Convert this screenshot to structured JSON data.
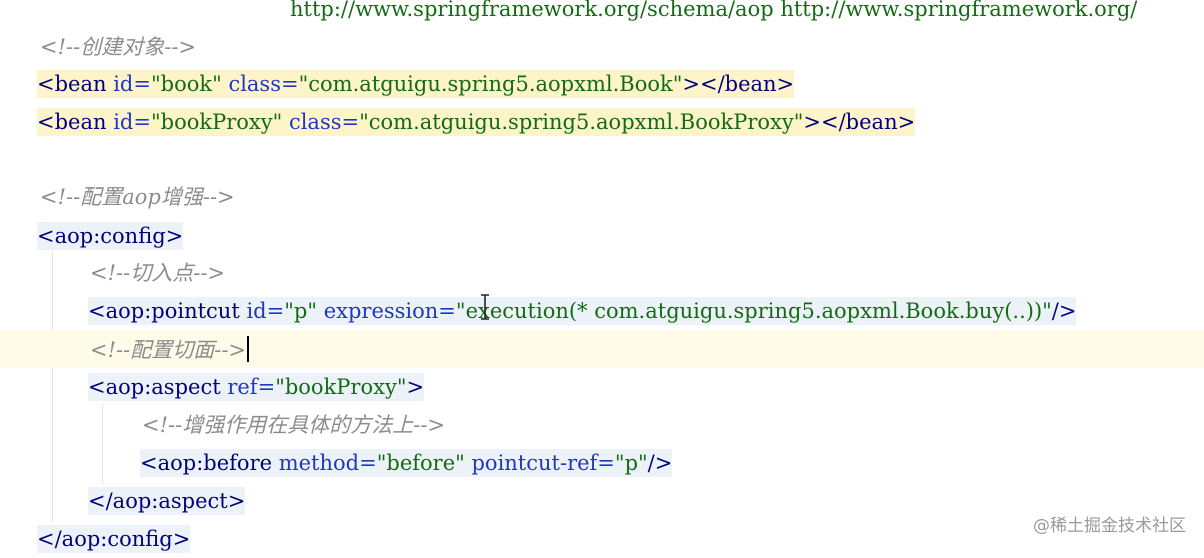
{
  "editor": {
    "line_url": "http://www.springframework.org/schema/aop http://www.springframework.org/",
    "comment_create": "<!--创建对象-->",
    "bean1": {
      "open": "<bean",
      "id_attr": "id=",
      "id_val": "\"book\"",
      "class_attr": "class=",
      "class_val": "\"com.atguigu.spring5.aopxml.Book\"",
      "close": "></bean>"
    },
    "bean2": {
      "open": "<bean",
      "id_attr": "id=",
      "id_val": "\"bookProxy\"",
      "class_attr": "class=",
      "class_val": "\"com.atguigu.spring5.aopxml.BookProxy\"",
      "close": "></bean>"
    },
    "comment_aop": "<!--配置aop增强-->",
    "config_open": "<aop:config>",
    "comment_pointcut": "<!--切入点-->",
    "pointcut": {
      "open": "<aop:pointcut",
      "id_attr": "id=",
      "id_val": "\"p\"",
      "expr_attr": "expression=",
      "expr_val": "\"execution(* com.atguigu.spring5.aopxml.Book.buy(..))\"",
      "close": "/>"
    },
    "comment_aspect": "<!--配置切面-->",
    "aspect": {
      "open": "<aop:aspect",
      "ref_attr": "ref=",
      "ref_val": "\"bookProxy\"",
      "close": ">"
    },
    "comment_method": "<!--增强作用在具体的方法上-->",
    "before": {
      "open": "<aop:before",
      "method_attr": "method=",
      "method_val": "\"before\"",
      "pref_attr": "pointcut-ref=",
      "pref_val": "\"p\"",
      "close": "/>"
    },
    "aspect_close": "</aop:aspect>",
    "config_close": "</aop:config>"
  },
  "watermark": "@稀土掘金技术社区",
  "colors": {
    "tag": "#00007f",
    "attr": "#1f37c4",
    "value": "#146b14",
    "comment": "#8c8c8c",
    "bean_highlight": "#fdf4c9"
  }
}
